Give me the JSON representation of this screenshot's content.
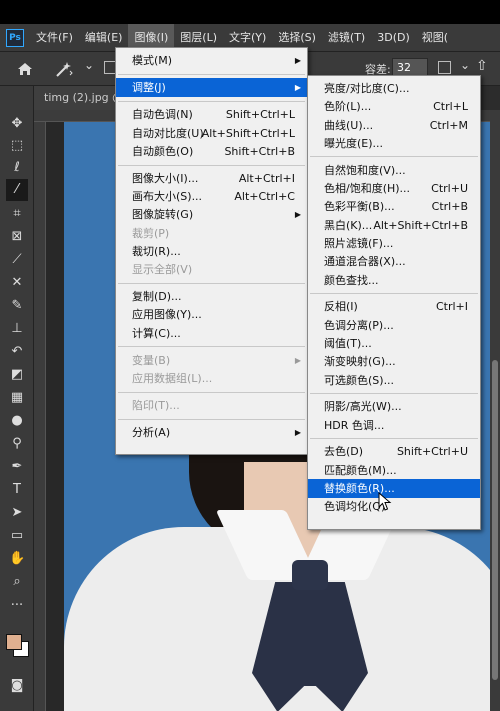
{
  "app": {
    "logo": "Ps",
    "menubar": [
      "文件(F)",
      "编辑(E)",
      "图像(I)",
      "图层(L)",
      "文字(Y)",
      "选择(S)",
      "滤镜(T)",
      "3D(D)",
      "视图("
    ],
    "active_menu_index": 2
  },
  "options": {
    "tolerance_label": "容差:",
    "tolerance_value": "32"
  },
  "document": {
    "tab_label": "timg (2).jpg @"
  },
  "image_menu": {
    "items": [
      {
        "label": "模式(M)",
        "submenu": true,
        "disabled": false
      },
      {
        "sep": true
      },
      {
        "label": "调整(J)",
        "submenu": true,
        "highlight": true,
        "disabled": false
      },
      {
        "sep": true
      },
      {
        "label": "自动色调(N)",
        "shortcut": "Shift+Ctrl+L",
        "disabled": false
      },
      {
        "label": "自动对比度(U)",
        "shortcut": "Alt+Shift+Ctrl+L",
        "disabled": false
      },
      {
        "label": "自动颜色(O)",
        "shortcut": "Shift+Ctrl+B",
        "disabled": false
      },
      {
        "sep": true
      },
      {
        "label": "图像大小(I)...",
        "shortcut": "Alt+Ctrl+I",
        "disabled": false
      },
      {
        "label": "画布大小(S)...",
        "shortcut": "Alt+Ctrl+C",
        "disabled": false
      },
      {
        "label": "图像旋转(G)",
        "submenu": true,
        "disabled": false
      },
      {
        "label": "裁剪(P)",
        "disabled": true
      },
      {
        "label": "裁切(R)...",
        "disabled": false
      },
      {
        "label": "显示全部(V)",
        "disabled": true
      },
      {
        "sep": true
      },
      {
        "label": "复制(D)...",
        "disabled": false
      },
      {
        "label": "应用图像(Y)...",
        "disabled": false
      },
      {
        "label": "计算(C)...",
        "disabled": false
      },
      {
        "sep": true
      },
      {
        "label": "变量(B)",
        "submenu": true,
        "disabled": true
      },
      {
        "label": "应用数据组(L)...",
        "disabled": true
      },
      {
        "sep": true
      },
      {
        "label": "陷印(T)...",
        "disabled": true
      },
      {
        "sep": true
      },
      {
        "label": "分析(A)",
        "submenu": true,
        "disabled": false
      }
    ]
  },
  "adjust_menu": {
    "items": [
      {
        "label": "亮度/对比度(C)...",
        "disabled": false
      },
      {
        "label": "色阶(L)...",
        "shortcut": "Ctrl+L",
        "disabled": false
      },
      {
        "label": "曲线(U)...",
        "shortcut": "Ctrl+M",
        "disabled": false
      },
      {
        "label": "曝光度(E)...",
        "disabled": false
      },
      {
        "sep": true
      },
      {
        "label": "自然饱和度(V)...",
        "disabled": false
      },
      {
        "label": "色相/饱和度(H)...",
        "shortcut": "Ctrl+U",
        "disabled": false
      },
      {
        "label": "色彩平衡(B)...",
        "shortcut": "Ctrl+B",
        "disabled": false
      },
      {
        "label": "黑白(K)...",
        "shortcut": "Alt+Shift+Ctrl+B",
        "disabled": false
      },
      {
        "label": "照片滤镜(F)...",
        "disabled": false
      },
      {
        "label": "通道混合器(X)...",
        "disabled": false
      },
      {
        "label": "颜色查找...",
        "disabled": false
      },
      {
        "sep": true
      },
      {
        "label": "反相(I)",
        "shortcut": "Ctrl+I",
        "disabled": false
      },
      {
        "label": "色调分离(P)...",
        "disabled": false
      },
      {
        "label": "阈值(T)...",
        "disabled": false
      },
      {
        "label": "渐变映射(G)...",
        "disabled": false
      },
      {
        "label": "可选颜色(S)...",
        "disabled": false
      },
      {
        "sep": true
      },
      {
        "label": "阴影/高光(W)...",
        "disabled": false
      },
      {
        "label": "HDR 色调...",
        "disabled": false
      },
      {
        "sep": true
      },
      {
        "label": "去色(D)",
        "shortcut": "Shift+Ctrl+U",
        "disabled": false
      },
      {
        "label": "匹配颜色(M)...",
        "disabled": false
      },
      {
        "label": "替换颜色(R)...",
        "highlight": true,
        "disabled": false
      },
      {
        "label": "色调均化(Q)",
        "disabled": false
      }
    ]
  },
  "colors": {
    "menu_highlight": "#0a64d6",
    "photo_background": "#3a75b0",
    "foreground_swatch": "#e0b090"
  }
}
